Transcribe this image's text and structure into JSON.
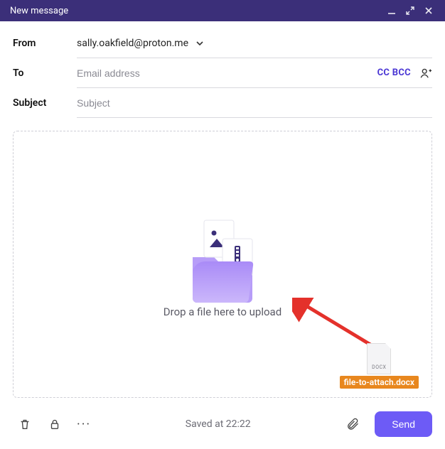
{
  "titlebar": {
    "title": "New message"
  },
  "form": {
    "from_label": "From",
    "from_value": "sally.oakfield@proton.me",
    "to_label": "To",
    "to_placeholder": "Email address",
    "to_value": "",
    "cc_label": "CC",
    "bcc_label": "BCC",
    "subject_label": "Subject",
    "subject_placeholder": "Subject",
    "subject_value": ""
  },
  "dropzone": {
    "text": "Drop a file here to upload",
    "dragged_file": {
      "name": "file-to-attach.docx",
      "ext": "DOCX"
    }
  },
  "footer": {
    "status": "Saved at 22:22",
    "send_label": "Send"
  }
}
